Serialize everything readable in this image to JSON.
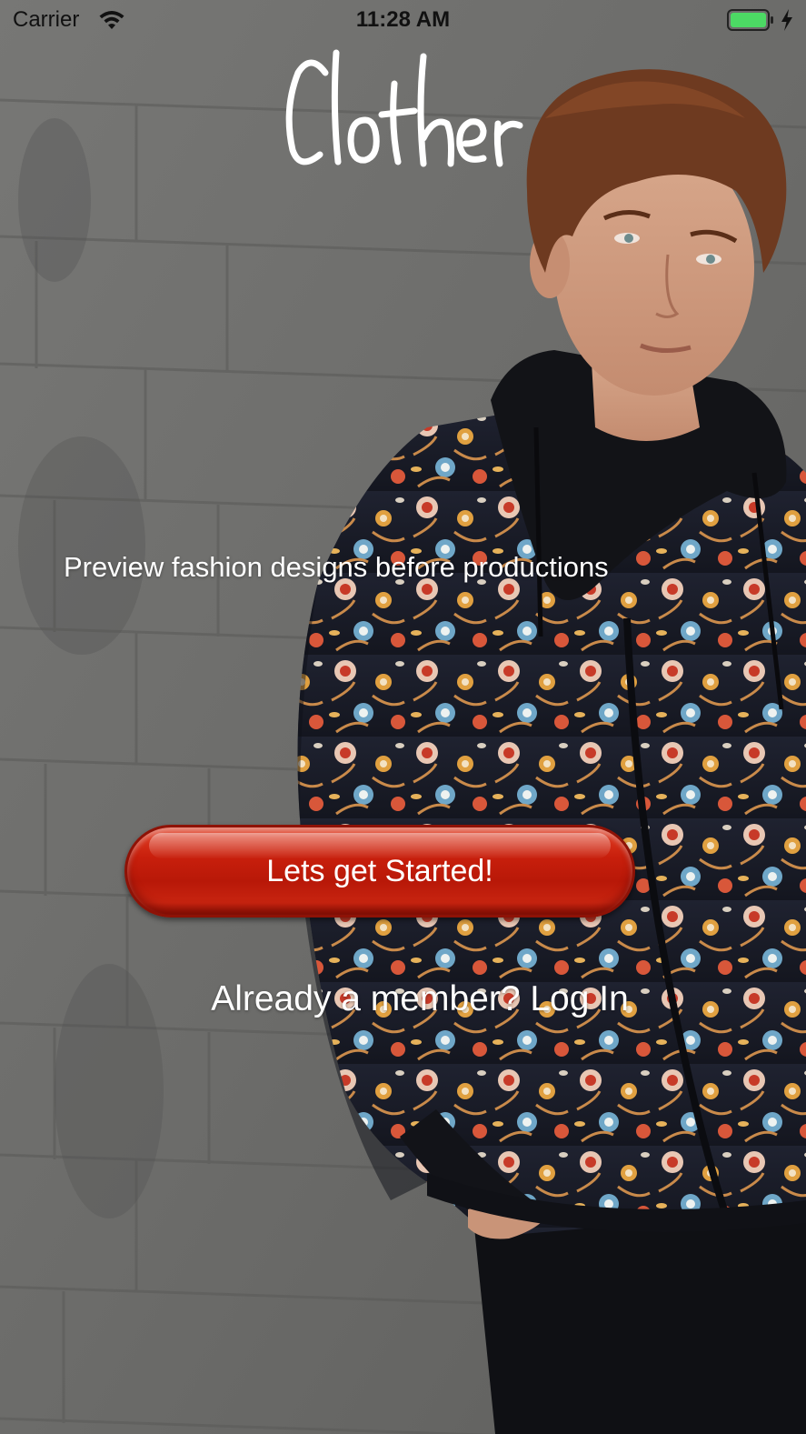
{
  "status_bar": {
    "carrier": "Carrier",
    "time": "11:28 AM",
    "wifi_icon": "wifi-icon",
    "battery_icon": "battery-full-icon",
    "charging_icon": "lightning-bolt-icon",
    "battery_level": 1.0,
    "battery_color": "#4cd964"
  },
  "app": {
    "logo_text": "Clother",
    "tagline": "Preview fashion designs before productions",
    "get_started_label": "Lets get Started!",
    "login_prompt": "Already a member? Log In"
  },
  "colors": {
    "button_red": "#c81f0c",
    "button_border": "#8e1206",
    "text_white": "#ffffff"
  }
}
